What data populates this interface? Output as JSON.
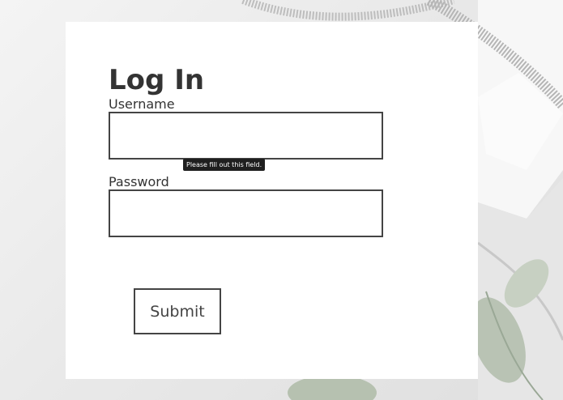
{
  "login": {
    "title": "Log In",
    "username_label": "Username",
    "username_value": "",
    "password_label": "Password",
    "password_value": "",
    "validation_tooltip": "Please fill out this field.",
    "submit_label": "Submit"
  },
  "colors": {
    "card": "#ffffff",
    "text": "#333333",
    "border": "#444444",
    "tooltip_bg": "#1f1f1f"
  }
}
